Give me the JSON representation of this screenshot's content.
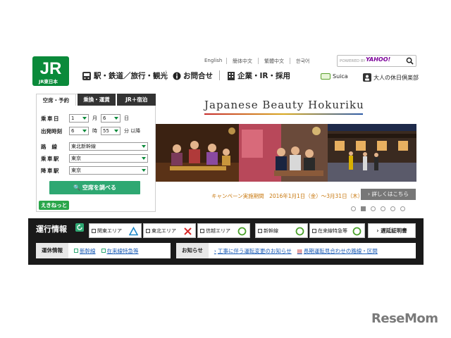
{
  "header": {
    "logo_text": "JR東日本",
    "languages": [
      "English",
      "簡体中文",
      "繁體中文",
      "한국어"
    ],
    "search": {
      "placeholder": "POWERED BY",
      "powered_by": "YAHOO!"
    },
    "nav": [
      "駅・鉄道／旅行・観光",
      "お問合せ",
      "企業・IR・採用"
    ],
    "suica": "Suica",
    "club": "大人の休日倶楽部"
  },
  "booking": {
    "tabs": [
      "空席・予約",
      "乗換・運賃",
      "JR＋宿泊"
    ],
    "date_label": "乗車日",
    "month": "1",
    "month_unit": "月",
    "day": "6",
    "day_unit": "日",
    "time_label": "出発時刻",
    "hour": "6",
    "hour_unit": "時",
    "minute": "55",
    "minute_unit": "分 以降",
    "route_label": "路線",
    "route_value": "東北新幹線",
    "from_label": "乗車駅",
    "from_value": "東京",
    "to_label": "降車駅",
    "to_value": "東京",
    "search_button": "空席を調べる",
    "ekinet": "えきねっと"
  },
  "banner": {
    "title": "Japanese Beauty Hokuriku",
    "campaign": "キャンペーン実施期間　2016年1月1日（金）～3月31日（木）",
    "detail_button": "詳しくはこちら",
    "slides": 6,
    "current_slide": 2
  },
  "status": {
    "title": "運行情報",
    "areas": [
      {
        "label": "関東エリア",
        "state": "delay-icon"
      },
      {
        "label": "東北エリア",
        "state": "suspend-icon"
      },
      {
        "label": "信越エリア",
        "state": "normal-icon"
      },
      {
        "label": "新幹線",
        "state": "normal-icon"
      },
      {
        "label": "在来線特急等",
        "state": "normal-icon"
      }
    ],
    "delay_cert": "遅延証明書",
    "suspension_label": "運休情報",
    "suspension_links": [
      "新幹線",
      "在来線特急等"
    ],
    "notice_label": "お知らせ",
    "notice_links": [
      "工事に伴う運転変更のお知らせ",
      "長期運転見合わせの路線・区間"
    ]
  },
  "watermark": "ReseMom",
  "colors": {
    "brand_green": "#0a8a3a",
    "button_green": "#2ea872",
    "dark_band": "#1a1a1a",
    "link": "#1a5bb5"
  }
}
